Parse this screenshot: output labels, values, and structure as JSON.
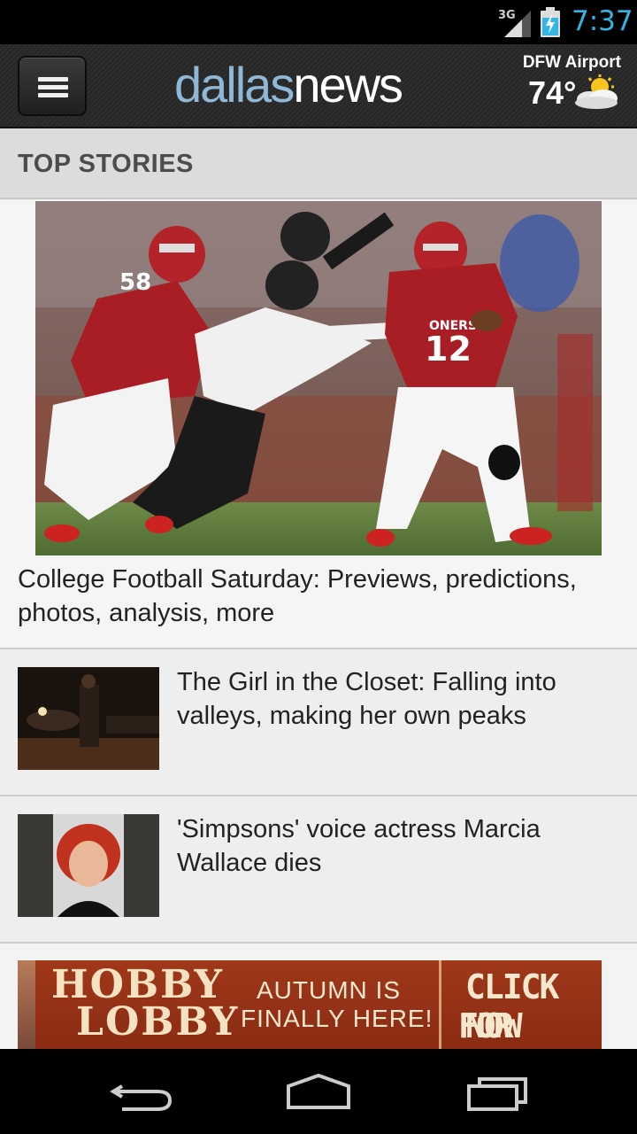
{
  "status_bar": {
    "network": "3G",
    "time": "7:37",
    "accent_color": "#33b5e5"
  },
  "header": {
    "logo_part1": "dallas",
    "logo_part2": "news",
    "weather_location": "DFW Airport",
    "weather_temp": "74°",
    "weather_icon": "partly-cloudy-icon"
  },
  "section": {
    "title": "TOP STORIES"
  },
  "stories": [
    {
      "title": "College Football Saturday: Previews, predictions, photos, analysis, more"
    },
    {
      "title": "The Girl in the Closet: Falling into valleys, making her own peaks"
    },
    {
      "title": "'Simpsons' voice actress Marcia Wallace dies"
    }
  ],
  "ad": {
    "brand_line1": "HOBBY",
    "brand_line2": "LOBBY",
    "message_line1": "AUTUMN IS",
    "message_line2": "FINALLY HERE!",
    "cta_line1": "CLICK NOW",
    "cta_line2": "FOR COUPON"
  },
  "nav": {
    "back_icon": "back-icon",
    "home_icon": "home-icon",
    "recents_icon": "recents-icon"
  }
}
